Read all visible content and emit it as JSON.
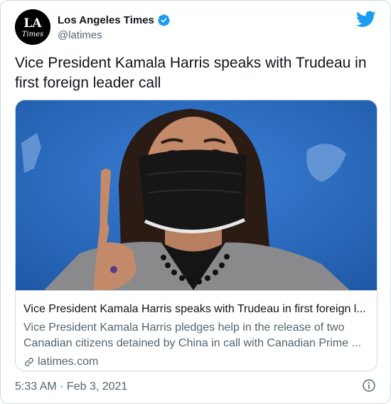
{
  "author": {
    "display_name": "Los Angeles Times",
    "handle": "@latimes",
    "avatar_text": "LA Times",
    "verified": true
  },
  "tweet": {
    "text": "Vice President Kamala Harris speaks with Trudeau in first foreign leader call"
  },
  "card": {
    "title": "Vice President Kamala Harris speaks with Trudeau in first foreign l...",
    "description_line1": "Vice President Kamala Harris pledges help in the release of two",
    "description_line2": "Canadian citizens detained by China in call with Canadian Prime ...",
    "domain": "latimes.com"
  },
  "footer": {
    "timestamp": "5:33 AM · Feb 3, 2021"
  },
  "icons": {
    "brand": "twitter-bird-icon",
    "verified": "verified-badge-icon",
    "link": "link-icon",
    "info": "info-icon"
  },
  "colors": {
    "twitter_blue": "#1d9bf0",
    "text_primary": "#0f1419",
    "text_secondary": "#536471",
    "border": "#cfd9de",
    "photo_background": "#2f6fc6"
  }
}
